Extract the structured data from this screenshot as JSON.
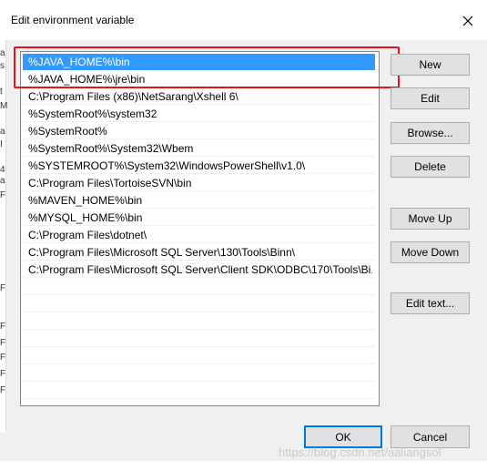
{
  "dialog": {
    "title": "Edit environment variable",
    "close_symbol": "✕"
  },
  "left_edge_glyphs": [
    "a",
    "s",
    "t",
    "M",
    "a",
    "I",
    "4",
    "a",
    "F",
    "F",
    "F",
    "F",
    "F",
    "F",
    "F"
  ],
  "paths": [
    "%JAVA_HOME%\\bin",
    "%JAVA_HOME%\\jre\\bin",
    "C:\\Program Files (x86)\\NetSarang\\Xshell 6\\",
    "%SystemRoot%\\system32",
    "%SystemRoot%",
    "%SystemRoot%\\System32\\Wbem",
    "%SYSTEMROOT%\\System32\\WindowsPowerShell\\v1.0\\",
    "C:\\Program Files\\TortoiseSVN\\bin",
    "%MAVEN_HOME%\\bin",
    "%MYSQL_HOME%\\bin",
    "C:\\Program Files\\dotnet\\",
    "C:\\Program Files\\Microsoft SQL Server\\130\\Tools\\Binn\\",
    "C:\\Program Files\\Microsoft SQL Server\\Client SDK\\ODBC\\170\\Tools\\Bi..."
  ],
  "selected_index": 0,
  "buttons": {
    "new": "New",
    "edit": "Edit",
    "browse": "Browse...",
    "delete": "Delete",
    "move_up": "Move Up",
    "move_down": "Move Down",
    "edit_text": "Edit text...",
    "ok": "OK",
    "cancel": "Cancel"
  },
  "colors": {
    "selection": "#3399ff",
    "highlight_box": "#e8121a",
    "primary_border": "#0078d7"
  },
  "watermark": "https://blog.csdn.net/aaliangsol"
}
